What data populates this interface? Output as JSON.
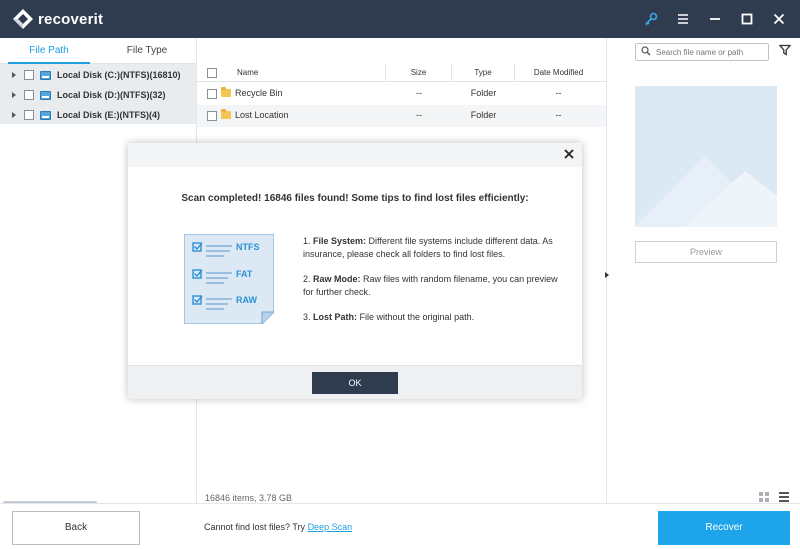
{
  "app": {
    "name": "recoverit"
  },
  "titlebar": {
    "icons": [
      "key-icon",
      "menu-icon",
      "minimize-icon",
      "maximize-icon",
      "close-icon"
    ]
  },
  "left": {
    "tabs": [
      {
        "label": "File Path",
        "active": true
      },
      {
        "label": "File Type",
        "active": false
      }
    ],
    "drives": [
      {
        "label": "Local Disk (C:)(NTFS)(16810)"
      },
      {
        "label": "Local Disk (D:)(NTFS)(32)"
      },
      {
        "label": "Local Disk (E:)(NTFS)(4)"
      }
    ]
  },
  "table": {
    "headers": {
      "name": "Name",
      "size": "Size",
      "type": "Type",
      "date": "Date Modified"
    },
    "rows": [
      {
        "name": "Recycle Bin",
        "size": "--",
        "type": "Folder",
        "date": "--"
      },
      {
        "name": "Lost Location",
        "size": "--",
        "type": "Folder",
        "date": "--"
      }
    ],
    "status": "16846 items, 3.78  GB"
  },
  "right": {
    "search_placeholder": "Search file name or path",
    "preview_label": "Preview"
  },
  "bottom": {
    "back_label": "Back",
    "deep_prefix": "Cannot find lost files? Try ",
    "deep_link": "Deep Scan",
    "recover_label": "Recover"
  },
  "dialog": {
    "title": "Scan completed! 16846 files found! Some tips to find lost files efficiently:",
    "illus_labels": [
      "NTFS",
      "FAT",
      "RAW"
    ],
    "tips": [
      {
        "num": "1. ",
        "head": "File System:",
        "text": " Different file systems include different data. As insurance, please check all folders to find lost files."
      },
      {
        "num": "2. ",
        "head": "Raw Mode:",
        "text": "  Raw files with random filename, you can preview for further check."
      },
      {
        "num": "3. ",
        "head": "Lost Path:",
        "text": " File without the original path."
      }
    ],
    "ok_label": "OK"
  },
  "colors": {
    "titlebar": "#2f3b4e",
    "accent": "#1e9ee0",
    "recover": "#1ea4ea"
  }
}
